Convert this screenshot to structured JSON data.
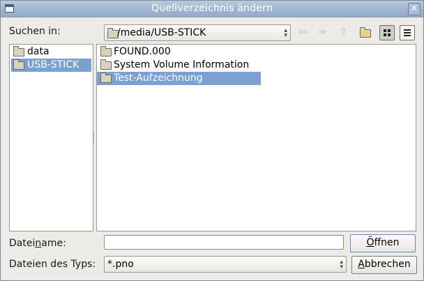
{
  "window": {
    "title": "Quellverzeichnis ändern",
    "close_label": "✕"
  },
  "location": {
    "label": "Suchen in:",
    "path": "/media/USB-STICK"
  },
  "toolbar": {
    "icons": [
      "arrow-back-icon",
      "arrow-forward-icon",
      "arrow-up-icon",
      "new-folder-icon",
      "icon-view-icon",
      "list-view-icon"
    ]
  },
  "places": [
    {
      "label": "data",
      "selected": false
    },
    {
      "label": "USB-STICK",
      "selected": true
    }
  ],
  "files": [
    {
      "label": "FOUND.000",
      "selected": false
    },
    {
      "label": "System Volume Information",
      "selected": false
    },
    {
      "label": "Test-Aufzeichnung",
      "selected": true
    }
  ],
  "filename": {
    "label_pre": "Datei",
    "label_ul": "n",
    "label_post": "ame:",
    "value": ""
  },
  "filetype": {
    "label": "Dateien des Typs:",
    "value": "*.pno"
  },
  "buttons": {
    "open_ul": "Ö",
    "open_rest": "ffnen",
    "cancel_ul": "A",
    "cancel_rest": "bbrechen"
  },
  "colors": {
    "selection": "#7ca0cf",
    "titlebar": "#9fb6d1",
    "dialog_bg": "#ecebe8"
  }
}
